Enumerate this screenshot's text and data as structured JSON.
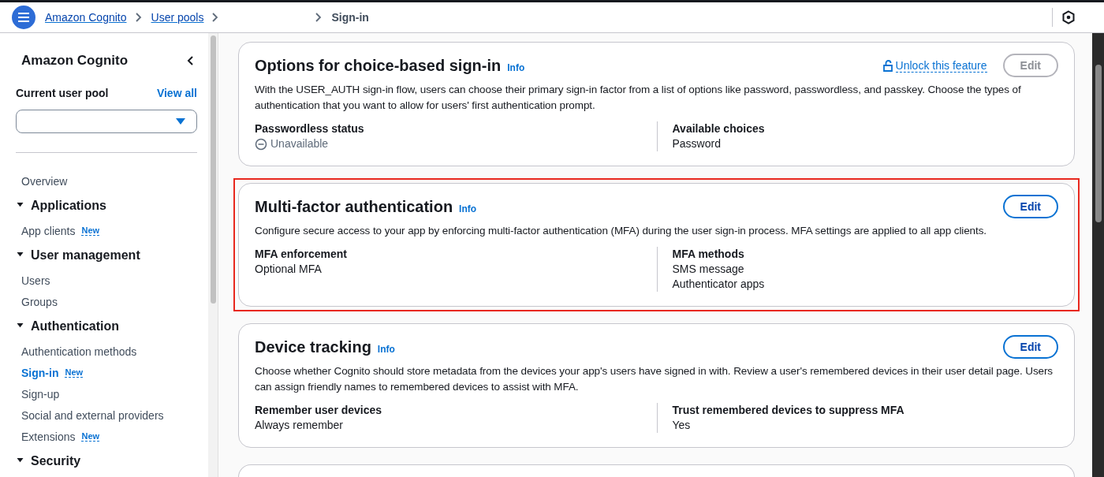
{
  "breadcrumbs": [
    {
      "label": "Amazon Cognito",
      "link": true
    },
    {
      "label": "User pools",
      "link": true
    },
    {
      "label": "Sign-in",
      "link": false,
      "gap_before": true
    }
  ],
  "sidebar": {
    "title": "Amazon Cognito",
    "pool_label": "Current user pool",
    "view_all": "View all",
    "items": [
      {
        "kind": "item",
        "label": "Overview",
        "selected": false
      },
      {
        "kind": "section",
        "label": "Applications",
        "expanded": true,
        "children": [
          {
            "label": "App clients",
            "badge": "New",
            "selected": false
          }
        ]
      },
      {
        "kind": "section",
        "label": "User management",
        "expanded": true,
        "children": [
          {
            "label": "Users",
            "selected": false
          },
          {
            "label": "Groups",
            "selected": false
          }
        ]
      },
      {
        "kind": "section",
        "label": "Authentication",
        "expanded": true,
        "children": [
          {
            "label": "Authentication methods",
            "selected": false
          },
          {
            "label": "Sign-in",
            "badge": "New",
            "selected": true
          },
          {
            "label": "Sign-up",
            "selected": false
          },
          {
            "label": "Social and external providers",
            "selected": false
          },
          {
            "label": "Extensions",
            "badge": "New",
            "selected": false
          }
        ]
      },
      {
        "kind": "section",
        "label": "Security",
        "expanded": true
      }
    ]
  },
  "cards": [
    {
      "title": "Options for choice-based sign-in",
      "info": "Info",
      "unlock": "Unlock this feature",
      "edit": "Edit",
      "edit_disabled": true,
      "highlighted": false,
      "description": "With the USER_AUTH sign-in flow, users can choose their primary sign-in factor from a list of options like password, passwordless, and passkey. Choose the types of authentication that you want to allow for users' first authentication prompt.",
      "fields": [
        {
          "kind": "status",
          "label": "Passwordless status",
          "values": [
            "Unavailable"
          ]
        },
        {
          "kind": "text",
          "label": "Available choices",
          "values": [
            "Password"
          ]
        }
      ]
    },
    {
      "title": "Multi-factor authentication",
      "info": "Info",
      "edit": "Edit",
      "edit_disabled": false,
      "highlighted": true,
      "description": "Configure secure access to your app by enforcing multi-factor authentication (MFA) during the user sign-in process. MFA settings are applied to all app clients.",
      "fields": [
        {
          "kind": "text",
          "label": "MFA enforcement",
          "values": [
            "Optional MFA"
          ]
        },
        {
          "kind": "text",
          "label": "MFA methods",
          "values": [
            "SMS message",
            "Authenticator apps"
          ]
        }
      ]
    },
    {
      "title": "Device tracking",
      "info": "Info",
      "edit": "Edit",
      "edit_disabled": false,
      "highlighted": false,
      "description": "Choose whether Cognito should store metadata from the devices your app's users have signed in with. Review a user's remembered devices in their user detail page. Users can assign friendly names to remembered devices to assist with MFA.",
      "fields": [
        {
          "kind": "text",
          "label": "Remember user devices",
          "values": [
            "Always remember"
          ]
        },
        {
          "kind": "text",
          "label": "Trust remembered devices to suppress MFA",
          "values": [
            "Yes"
          ]
        }
      ]
    },
    {
      "kind": "cut_off",
      "highlighted": false
    }
  ]
}
